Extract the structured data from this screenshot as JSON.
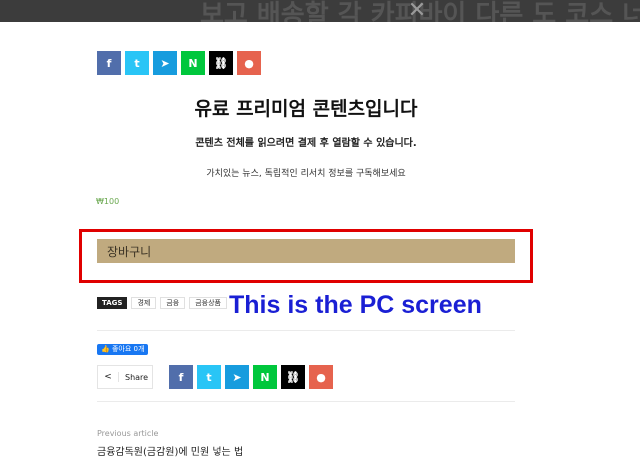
{
  "top_bar": {
    "partial_text": "보고 배송할 각 카피바이 다른 도 코스 너르",
    "close_icon": "close-icon"
  },
  "share_buttons": [
    {
      "icon": "facebook-icon",
      "glyph": "f",
      "color": "#516eab"
    },
    {
      "icon": "twitter-icon",
      "glyph": "t",
      "color": "#29c5f6"
    },
    {
      "icon": "telegram-icon",
      "glyph": "➤",
      "color": "#179cde"
    },
    {
      "icon": "naver-icon",
      "glyph": "N",
      "color": "#00c73c"
    },
    {
      "icon": "link-icon",
      "glyph": "⛓",
      "color": "#000000"
    },
    {
      "icon": "kakao-icon",
      "glyph": "●",
      "color": "#e6634e"
    }
  ],
  "paywall": {
    "title": "유료 프리미엄 콘텐츠입니다",
    "subtitle": "콘텐츠 전체를 읽으려면 결제 후 열람할 수 있습니다.",
    "description": "가치있는 뉴스, 독립적인 리서치 정보를 구독해보세요",
    "price": "₩100",
    "cart_label": "장바구니"
  },
  "tags": {
    "label": "TAGS",
    "items": [
      "경제",
      "금융",
      "금융상품"
    ]
  },
  "annotation": "This is the PC screen",
  "like": {
    "label": "👍 좋아요 0개"
  },
  "share_box": {
    "icon": "share-icon",
    "label": "Share"
  },
  "previous_article": {
    "label": "Previous article",
    "title": "금융감독원(금감원)에 민원 넣는 법"
  },
  "colors": {
    "cart": "#c0aa7f",
    "highlight": "#e00000",
    "annotation": "#1a1fd4",
    "price": "#6aa84f"
  }
}
